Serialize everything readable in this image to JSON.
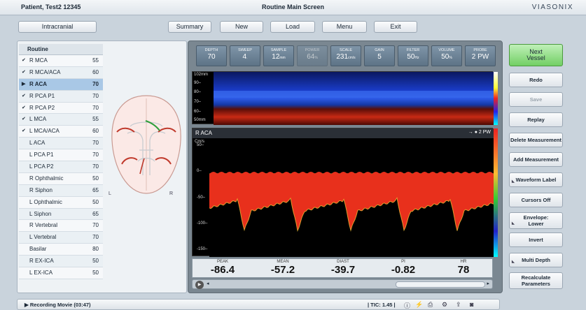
{
  "titlebar": {
    "patient": "Patient, Test2   12345",
    "screen_title": "Routine Main Screen",
    "brand": "VIASONIX"
  },
  "topbar": {
    "mode": "Intracranial",
    "summary": "Summary",
    "new": "New",
    "load": "Load",
    "menu": "Menu",
    "exit": "Exit"
  },
  "vessels": {
    "header": "Routine",
    "items": [
      {
        "check": "✔",
        "name": "R MCA",
        "depth": "55"
      },
      {
        "check": "✔",
        "name": "R MCA/ACA",
        "depth": "60"
      },
      {
        "check": "▶",
        "name": "R ACA",
        "depth": "70",
        "selected": true
      },
      {
        "check": "✔",
        "name": "R PCA P1",
        "depth": "70"
      },
      {
        "check": "✔",
        "name": "R PCA P2",
        "depth": "70"
      },
      {
        "check": "✔",
        "name": "L MCA",
        "depth": "55"
      },
      {
        "check": "✔",
        "name": "L MCA/ACA",
        "depth": "60"
      },
      {
        "check": "",
        "name": "L ACA",
        "depth": "70"
      },
      {
        "check": "",
        "name": "L PCA P1",
        "depth": "70"
      },
      {
        "check": "",
        "name": "L PCA P2",
        "depth": "70"
      },
      {
        "check": "",
        "name": "R Ophthalmic",
        "depth": "50"
      },
      {
        "check": "",
        "name": "R Siphon",
        "depth": "65"
      },
      {
        "check": "",
        "name": "L Ophthalmic",
        "depth": "50"
      },
      {
        "check": "",
        "name": "L Siphon",
        "depth": "65"
      },
      {
        "check": "",
        "name": "R Vertebral",
        "depth": "70"
      },
      {
        "check": "",
        "name": "L Vertebral",
        "depth": "70"
      },
      {
        "check": "",
        "name": "Basilar",
        "depth": "80"
      },
      {
        "check": "",
        "name": "R EX-ICA",
        "depth": "50"
      },
      {
        "check": "",
        "name": "L EX-ICA",
        "depth": "50"
      }
    ]
  },
  "brain": {
    "left": "L",
    "right": "R"
  },
  "params": [
    {
      "label": "DEPTH",
      "value": "70",
      "unit": ""
    },
    {
      "label": "SWEEP",
      "value": "4",
      "unit": "."
    },
    {
      "label": "SAMPLE",
      "value": "12",
      "unit": "mm"
    },
    {
      "label": "POWER",
      "value": "64",
      "unit": "%"
    },
    {
      "label": "SCALE",
      "value": "231",
      "unit": "cm/s"
    },
    {
      "label": "GAIN",
      "value": "5",
      "unit": ""
    },
    {
      "label": "FILTER",
      "value": "50",
      "unit": "Hz"
    },
    {
      "label": "VOLUME",
      "value": "50",
      "unit": "%"
    },
    {
      "label": "PROBE",
      "value": "2 PW",
      "unit": ""
    }
  ],
  "mmode": {
    "ticks": [
      "102mm",
      "90–",
      "80–",
      "70–",
      "60–",
      "50mm"
    ]
  },
  "doppler": {
    "vessel": "R ACA",
    "probe_indicator": "→ ● 2 PW",
    "unit": "Cm/s",
    "ticks": [
      "50–",
      "0–",
      "-50–",
      "-100–",
      "-150–"
    ]
  },
  "readout": [
    {
      "label": "PEAK",
      "value": "-86.4"
    },
    {
      "label": "MEAN",
      "value": "-57.2"
    },
    {
      "label": "DIAST",
      "value": "-39.7"
    },
    {
      "label": "PI",
      "value": "-0.82"
    },
    {
      "label": "HR",
      "value": "78"
    }
  ],
  "right_buttons": {
    "next": "Next\nVessel",
    "redo": "Redo",
    "save": "Save",
    "replay": "Replay",
    "delete_measurement": "Delete Measurement",
    "add_measurement": "Add Measurement",
    "waveform_label": "Waveform Label",
    "cursors_off": "Cursors Off",
    "envelope": "Envelope:\nLower",
    "invert": "Invert",
    "multi_depth": "Multi Depth",
    "recalculate": "Recalculate\nParameters"
  },
  "status": {
    "recording": "▶ Recording Movie (03:47)",
    "tic": "| TIC: 1.45 |"
  },
  "colors": {
    "next_green": "#72cf64",
    "selected_row": "#a9c8e6",
    "spectrum_red": "#e8301c",
    "mmode_blue": "#1a3cc8"
  }
}
